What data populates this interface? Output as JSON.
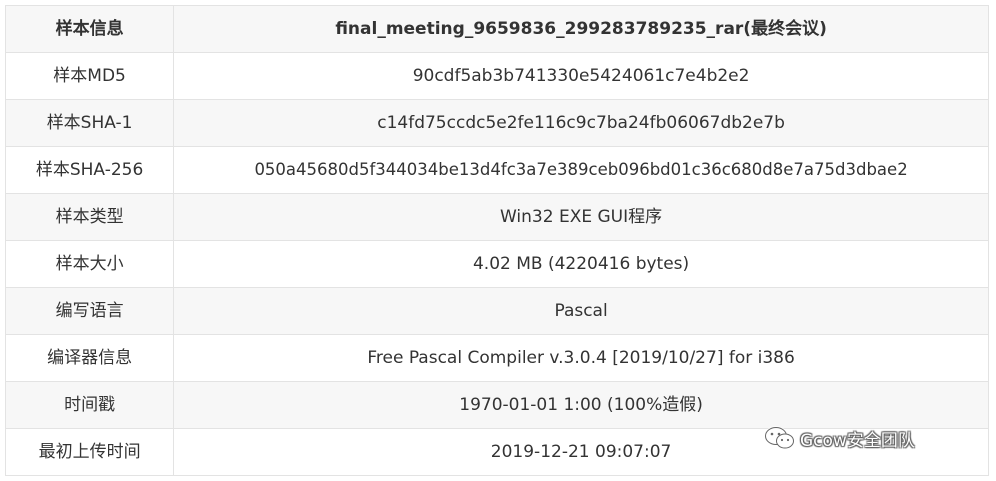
{
  "header": {
    "label": "样本信息",
    "value": "final_meeting_9659836_299283789235_rar(最终会议)"
  },
  "rows": [
    {
      "label": "样本MD5",
      "value": "90cdf5ab3b741330e5424061c7e4b2e2"
    },
    {
      "label": "样本SHA-1",
      "value": "c14fd75ccdc5e2fe116c9c7ba24fb06067db2e7b"
    },
    {
      "label": "样本SHA-256",
      "value": "050a45680d5f344034be13d4fc3a7e389ceb096bd01c36c680d8e7a75d3dbae2"
    },
    {
      "label": "样本类型",
      "value": "Win32 EXE GUI程序"
    },
    {
      "label": "样本大小",
      "value": "4.02 MB (4220416 bytes)"
    },
    {
      "label": "编写语言",
      "value": "Pascal"
    },
    {
      "label": "编译器信息",
      "value": "Free Pascal Compiler v.3.0.4 [2019/10/27] for i386"
    },
    {
      "label": "时间戳",
      "value": "1970-01-01 1:00 (100%造假)"
    },
    {
      "label": "最初上传时间",
      "value": "2019-12-21 09:07:07"
    }
  ],
  "watermark": {
    "icon": "wechat-icon",
    "text": "Gcow安全团队"
  }
}
